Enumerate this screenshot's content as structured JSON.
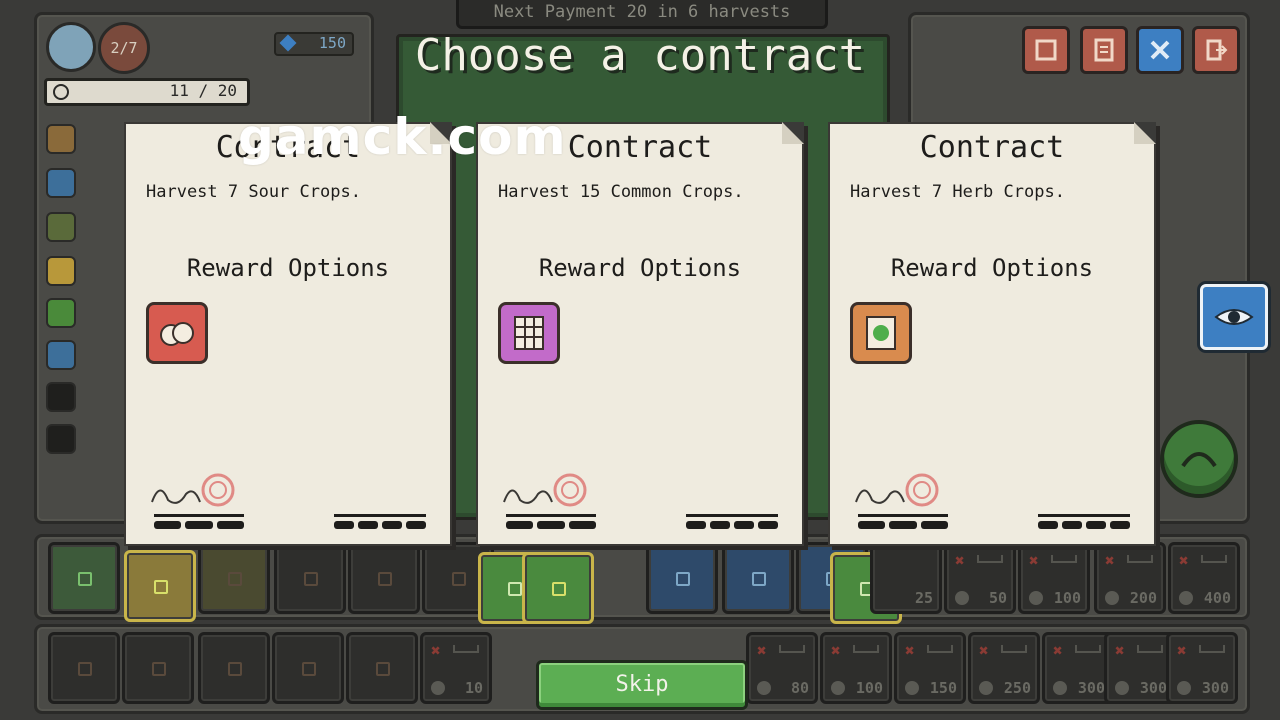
{
  "header": {
    "payment_text": "Next Payment 20 in 6 harvests",
    "title": "Choose a contract"
  },
  "stats": {
    "turns": "2/7",
    "gems": "150",
    "progress": "11 / 20",
    "progress_value": 0.55
  },
  "contracts": [
    {
      "title": "Contract",
      "description": "Harvest 7 Sour Crops.",
      "reward_heading": "Reward Options",
      "reward_icon": "sour-crop-reward-icon",
      "reward_color": "#d75b50"
    },
    {
      "title": "Contract",
      "description": "Harvest 15 Common Crops.",
      "reward_heading": "Reward Options",
      "reward_icon": "grid-field-reward-icon",
      "reward_color": "#c26bc9"
    },
    {
      "title": "Contract",
      "description": "Harvest 7 Herb Crops.",
      "reward_heading": "Reward Options",
      "reward_icon": "herb-seed-reward-icon",
      "reward_color": "#d98b4e"
    }
  ],
  "shop_row1_prices": [
    "25",
    "50",
    "100",
    "200",
    "400"
  ],
  "shop_row2_prices": [
    "10",
    "80",
    "100",
    "150",
    "250",
    "300",
    "300",
    "300"
  ],
  "buttons": {
    "skip": "Skip"
  },
  "watermark": "gamck.com",
  "colors": {
    "skip_green": "#5cae53",
    "card_paper": "#efebdf",
    "eye_blue": "#3d7fc2"
  }
}
